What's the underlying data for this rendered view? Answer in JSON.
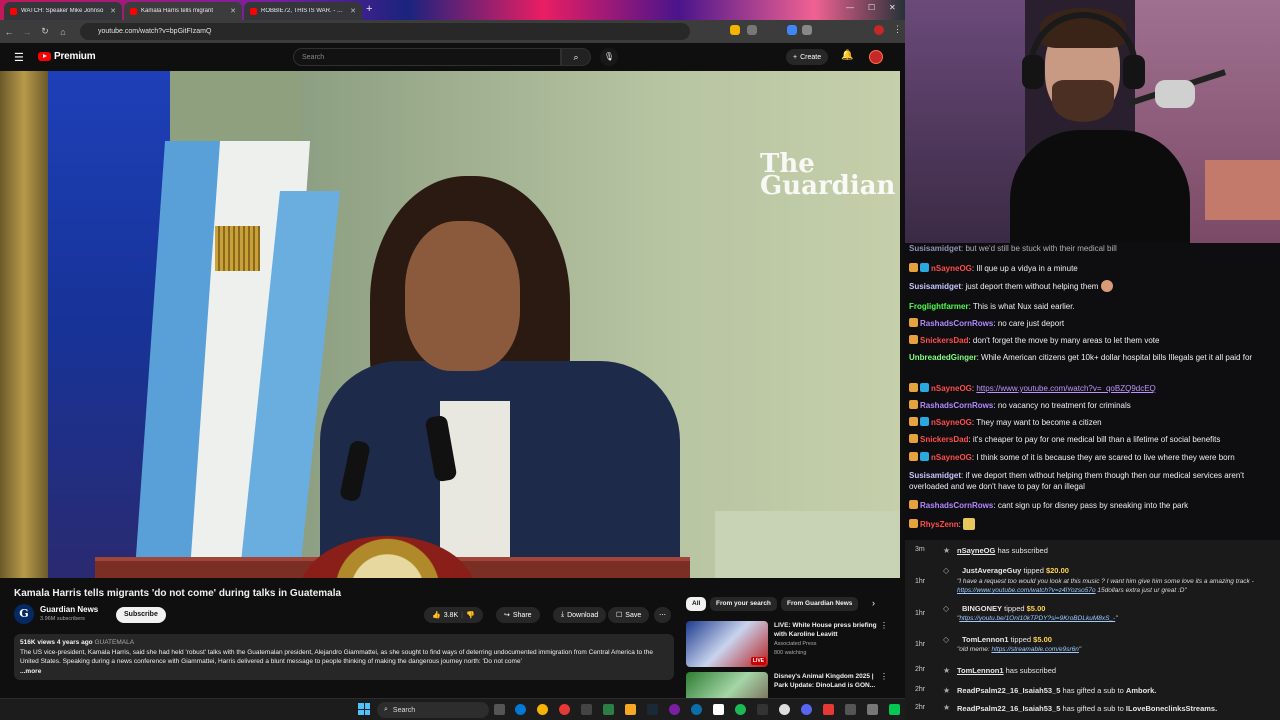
{
  "browser": {
    "tabs": [
      {
        "title": "WATCH: Speaker Mike Johnso",
        "active": false
      },
      {
        "title": "Kamala Harris tells migrant",
        "active": true
      },
      {
        "title": "ROBBIE72, THIS IS WAR. - You",
        "active": false
      }
    ],
    "url": "youtube.com/watch?v=bpGitFIzamQ"
  },
  "youtube": {
    "logo": "Premium",
    "search_placeholder": "Search",
    "create_label": "Create",
    "video": {
      "watermark": "The\nGuardian",
      "title": "Kamala Harris tells migrants 'do not come' during talks in Guatemala"
    },
    "channel": {
      "name": "Guardian News",
      "subscribers": "3.96M subscribers",
      "subscribe_label": "Subscribe"
    },
    "actions": {
      "likes": "3.8K",
      "share": "Share",
      "download": "Download",
      "save": "Save"
    },
    "description": {
      "meta": "516K views  4 years ago",
      "tag": "GUATEMALA",
      "text": "The US vice-president, Kamala Harris, said she had held 'robust' talks with the Guatemalan president, Alejandro Giammattei, as she sought to find ways of deterring undocumented immigration from Central America to the United States. Speaking during a news conference with Giammattei, Harris delivered a blunt message to people thinking of making the dangerous journey north: 'Do not come'",
      "more": "...more"
    },
    "chips": [
      "All",
      "From your search",
      "From Guardian News"
    ],
    "recommendations": [
      {
        "title": "LIVE: White House press briefing with Karoline Leavitt",
        "channel": "Associated Press",
        "views": "800 watching",
        "badge": "LIVE"
      },
      {
        "title": "Disney's Animal Kingdom 2025 | Park Update: DinoLand is GON...",
        "channel": "",
        "views": "",
        "badge": ""
      }
    ]
  },
  "taskbar": {
    "search_label": "Search"
  },
  "chat": [
    {
      "user": "Susisamidget",
      "color": "#c6c6ff",
      "text": "but we'd still be stuck with their medical bill",
      "link": ""
    },
    {
      "user": "nSayneOG",
      "color": "#ff4d4d",
      "text": "Ill que up a vidya in a minute",
      "link": ""
    },
    {
      "user": "Susisamidget",
      "color": "#c6c6ff",
      "text": "just deport them without helping them",
      "link": ""
    },
    {
      "user": "Froglightfarmer",
      "color": "#4dff4d",
      "text": "This is what Nux said earlier.",
      "link": ""
    },
    {
      "user": "RashadsCornRows",
      "color": "#b388ff",
      "text": "no care just deport",
      "link": ""
    },
    {
      "user": "SnickersDad",
      "color": "#ff4d4d",
      "text": "don't forget the move by many areas to let them vote",
      "link": ""
    },
    {
      "user": "UnbreadedGinger",
      "color": "#80ff80",
      "text": "While American citizens get 10k+ dollar hospital bills Illegals get it all paid for",
      "link": ""
    },
    {
      "user": "nSayneOG",
      "color": "#ff4d4d",
      "text": "",
      "link": "https://www.youtube.com/watch?v=_qoBZQ9dcEQ"
    },
    {
      "user": "RashadsCornRows",
      "color": "#b388ff",
      "text": "no vacancy no treatment for criminals",
      "link": ""
    },
    {
      "user": "nSayneOG",
      "color": "#ff4d4d",
      "text": "They may want to become a citizen",
      "link": ""
    },
    {
      "user": "SnickersDad",
      "color": "#ff4d4d",
      "text": "it's cheaper to pay for one medical bill than a lifetime of social benefits",
      "link": ""
    },
    {
      "user": "nSayneOG",
      "color": "#ff4d4d",
      "text": "I think some of it is because they are scared to live where they were born",
      "link": ""
    },
    {
      "user": "Susisamidget",
      "color": "#c6c6ff",
      "text": "if we deport them without helping them though then our medical services aren't overloaded and we don't have to pay for an illegal",
      "link": ""
    },
    {
      "user": "RashadsCornRows",
      "color": "#b388ff",
      "text": "cant sign up for disney pass by sneaking into the park",
      "link": ""
    },
    {
      "user": "RhysZenn",
      "color": "#ff4d4d",
      "text": "",
      "link": ""
    }
  ],
  "alerts": [
    {
      "time": "3m",
      "name": "nSayneOG",
      "action": "has subscribed",
      "amount": "",
      "message": "",
      "link": ""
    },
    {
      "time": "1hr",
      "name": "JustAverageGuy",
      "action": "tipped",
      "amount": "$20.00",
      "message": "\"I have a request too would you look at this music ? I want him give him some love its a amazing track - ",
      "link": "https://www.youtube.com/watch?v=z4lYozso57o",
      "suffix": " 15dollars extra just ur great :D\""
    },
    {
      "time": "1hr",
      "name": "BINGONEY",
      "action": "tipped",
      "amount": "$5.00",
      "message": "",
      "link": "https://youtu.be/1OnI10kTPDY?si=9KroBDLkuM8xS_-",
      "suffix": "\""
    },
    {
      "time": "1hr",
      "name": "TomLennon1",
      "action": "tipped",
      "amount": "$5.00",
      "message": "\"old meme: ",
      "link": "https://streamable.com/e9sr6n",
      "suffix": "\""
    },
    {
      "time": "2hr",
      "name": "TomLennon1",
      "action": "has subscribed",
      "amount": "",
      "message": "",
      "link": ""
    },
    {
      "time": "2hr",
      "name": "ReadPsalm22_16_Isaiah53_5",
      "action": "has gifted a sub to",
      "amount": "",
      "target": "Ambork.",
      "message": "",
      "link": ""
    },
    {
      "time": "2hr",
      "name": "ReadPsalm22_16_Isaiah53_5",
      "action": "has gifted a sub to",
      "amount": "",
      "target": "ILoveBoneclinksStreams.",
      "message": "",
      "link": ""
    }
  ]
}
